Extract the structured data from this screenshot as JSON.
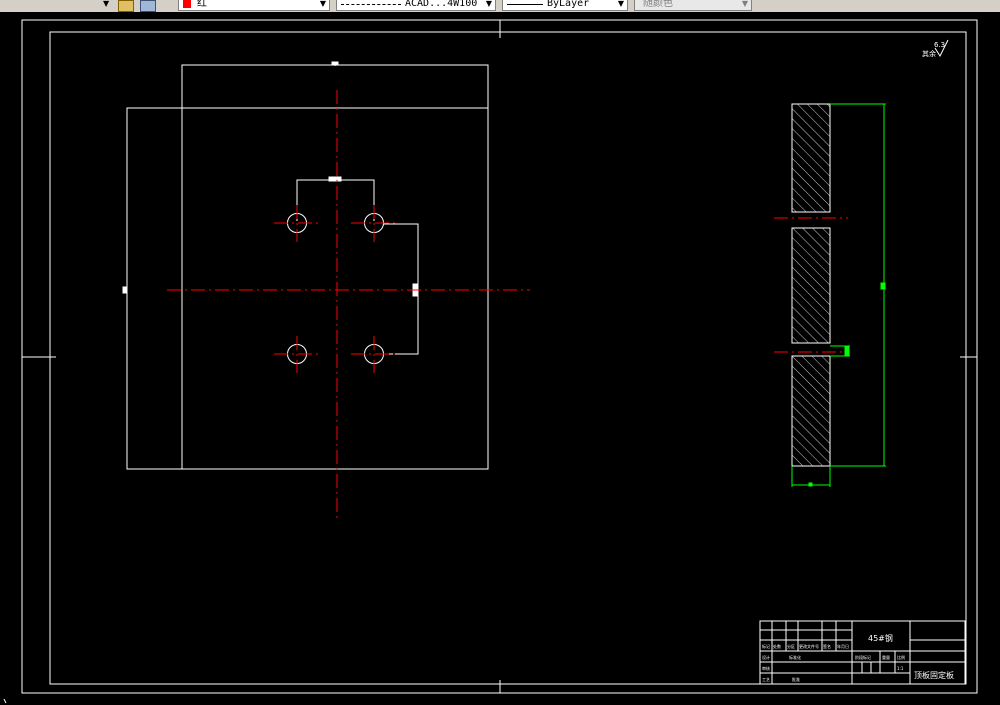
{
  "toolbar": {
    "color_label": "红",
    "linetype_label": "ACAD...4W100",
    "lineweight_label": "ByLayer",
    "plotstyle_label": "随颜色",
    "colors": {
      "red": "#ff0000"
    }
  },
  "drawing": {
    "surface_finish": "6.3",
    "surface_note": "其余",
    "colors": {
      "outline": "#ffffff",
      "centerline": "#ff0000",
      "dimension": "#00ff00",
      "background": "#000000"
    }
  },
  "title_block": {
    "material": "45#钢",
    "part_name": "顶板固定板",
    "labels": [
      "标记",
      "处数",
      "分区",
      "更改文件号",
      "签名",
      "年月日",
      "设计",
      "标准化",
      "审核",
      "工艺",
      "批准",
      "阶段标记",
      "重量",
      "比例",
      "1:1"
    ]
  }
}
